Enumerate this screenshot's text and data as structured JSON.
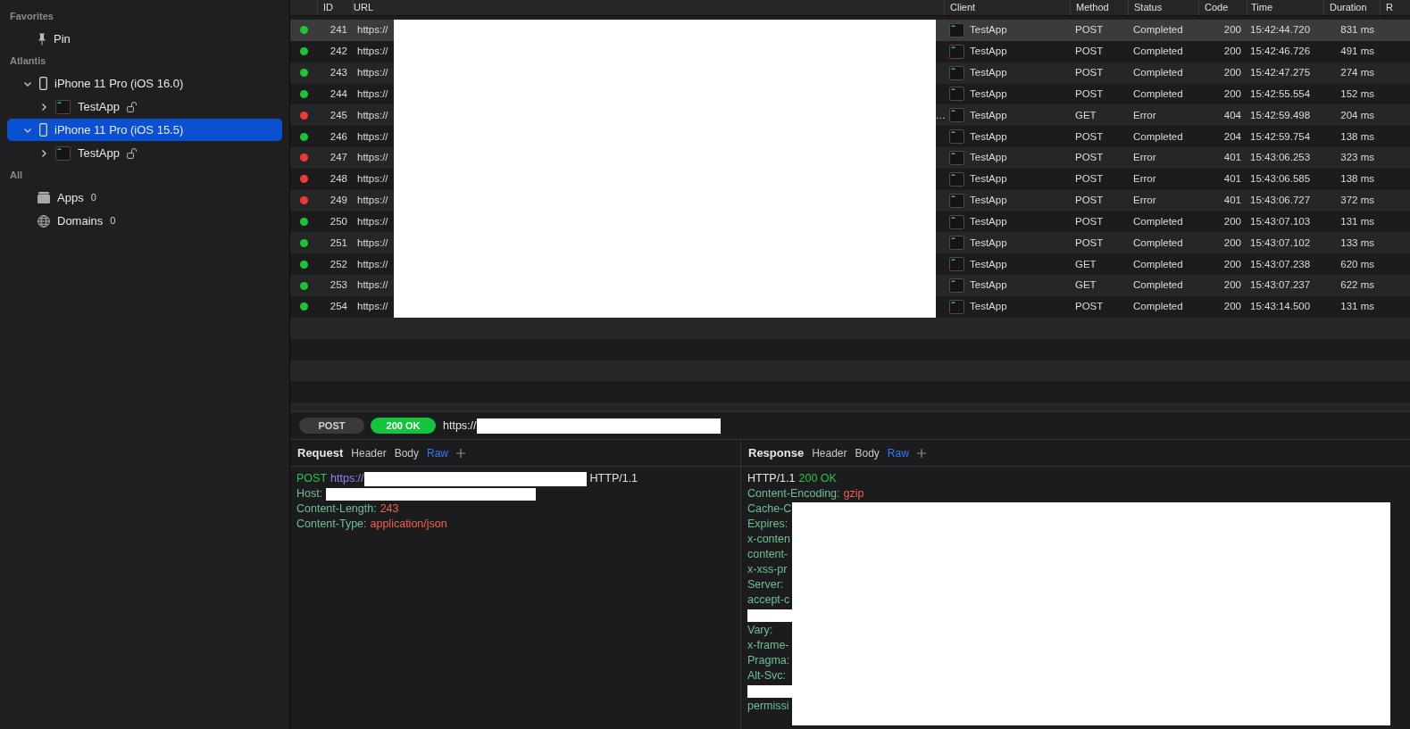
{
  "sidebar": {
    "sections": [
      {
        "title": "Favorites",
        "items": [
          {
            "kind": "pin",
            "label": "Pin",
            "selected": false
          }
        ]
      },
      {
        "title": "Atlantis",
        "items": [
          {
            "kind": "device",
            "label": "iPhone 11 Pro (iOS 16.0)",
            "selected": false,
            "expanded": true,
            "children": [
              {
                "kind": "app",
                "label": "TestApp",
                "selected": false,
                "expanded": false
              }
            ]
          },
          {
            "kind": "device",
            "label": "iPhone 11 Pro (iOS 15.5)",
            "selected": true,
            "expanded": true,
            "children": [
              {
                "kind": "app",
                "label": "TestApp",
                "selected": false,
                "expanded": false
              }
            ]
          }
        ]
      },
      {
        "title": "All",
        "items": [
          {
            "kind": "apps",
            "label": "Apps",
            "count": "0",
            "selected": false
          },
          {
            "kind": "domains",
            "label": "Domains",
            "count": "0",
            "selected": false
          }
        ]
      }
    ]
  },
  "table": {
    "columns": [
      "ID",
      "URL",
      "Client",
      "Method",
      "Status",
      "Code",
      "Time",
      "Duration",
      "R"
    ],
    "rows": [
      {
        "id": "241",
        "url": "https://",
        "client": "TestApp",
        "method": "POST",
        "status": "Completed",
        "code": "200",
        "time": "15:42:44.720",
        "duration": "831 ms",
        "color": "#1ec337",
        "selected": true
      },
      {
        "id": "242",
        "url": "https://",
        "client": "TestApp",
        "method": "POST",
        "status": "Completed",
        "code": "200",
        "time": "15:42:46.726",
        "duration": "491 ms",
        "color": "#1ec337",
        "selected": false
      },
      {
        "id": "243",
        "url": "https://",
        "client": "TestApp",
        "method": "POST",
        "status": "Completed",
        "code": "200",
        "time": "15:42:47.275",
        "duration": "274 ms",
        "color": "#1ec337",
        "selected": false
      },
      {
        "id": "244",
        "url": "https://",
        "client": "TestApp",
        "method": "POST",
        "status": "Completed",
        "code": "200",
        "time": "15:42:55.554",
        "duration": "152 ms",
        "color": "#1ec337",
        "selected": false
      },
      {
        "id": "245",
        "url": "https://",
        "url_end": "…",
        "client": "TestApp",
        "method": "GET",
        "status": "Error",
        "code": "404",
        "time": "15:42:59.498",
        "duration": "204 ms",
        "color": "#f0393a",
        "selected": false
      },
      {
        "id": "246",
        "url": "https://",
        "client": "TestApp",
        "method": "POST",
        "status": "Completed",
        "code": "204",
        "time": "15:42:59.754",
        "duration": "138 ms",
        "color": "#1ec337",
        "selected": false
      },
      {
        "id": "247",
        "url": "https://",
        "client": "TestApp",
        "method": "POST",
        "status": "Error",
        "code": "401",
        "time": "15:43:06.253",
        "duration": "323 ms",
        "color": "#f0393a",
        "selected": false
      },
      {
        "id": "248",
        "url": "https://",
        "client": "TestApp",
        "method": "POST",
        "status": "Error",
        "code": "401",
        "time": "15:43:06.585",
        "duration": "138 ms",
        "color": "#f0393a",
        "selected": false
      },
      {
        "id": "249",
        "url": "https://",
        "client": "TestApp",
        "method": "POST",
        "status": "Error",
        "code": "401",
        "time": "15:43:06.727",
        "duration": "372 ms",
        "color": "#f0393a",
        "selected": false
      },
      {
        "id": "250",
        "url": "https://",
        "client": "TestApp",
        "method": "POST",
        "status": "Completed",
        "code": "200",
        "time": "15:43:07.103",
        "duration": "131 ms",
        "color": "#1ec337",
        "selected": false
      },
      {
        "id": "251",
        "url": "https://",
        "client": "TestApp",
        "method": "POST",
        "status": "Completed",
        "code": "200",
        "time": "15:43:07.102",
        "duration": "133 ms",
        "color": "#1ec337",
        "selected": false
      },
      {
        "id": "252",
        "url": "https://",
        "client": "TestApp",
        "method": "GET",
        "status": "Completed",
        "code": "200",
        "time": "15:43:07.238",
        "duration": "620 ms",
        "color": "#1ec337",
        "selected": false
      },
      {
        "id": "253",
        "url": "https://",
        "client": "TestApp",
        "method": "GET",
        "status": "Completed",
        "code": "200",
        "time": "15:43:07.237",
        "duration": "622 ms",
        "color": "#1ec337",
        "selected": false
      },
      {
        "id": "254",
        "url": "https://",
        "client": "TestApp",
        "method": "POST",
        "status": "Completed",
        "code": "200",
        "time": "15:43:14.500",
        "duration": "131 ms",
        "color": "#1ec337",
        "selected": false
      }
    ]
  },
  "url_bar": {
    "method": "POST",
    "status": "200 OK",
    "url": "https://"
  },
  "request": {
    "title": "Request",
    "tabs": [
      {
        "label": "Header",
        "selected": false
      },
      {
        "label": "Body",
        "selected": false
      },
      {
        "label": "Raw",
        "selected": true
      }
    ],
    "lines": [
      {
        "kind": "request_line",
        "method": "POST",
        "url": "https://",
        "version": "HTTP/1.1"
      },
      {
        "kind": "redacted_header",
        "name": "Host:"
      },
      {
        "kind": "header",
        "name": "Content-Length:",
        "value": "243"
      },
      {
        "kind": "header",
        "name": "Content-Type:",
        "value": "application/json"
      }
    ]
  },
  "response": {
    "title": "Response",
    "tabs": [
      {
        "label": "Header",
        "selected": false
      },
      {
        "label": "Body",
        "selected": false
      },
      {
        "label": "Raw",
        "selected": true
      }
    ],
    "lines": [
      {
        "kind": "status_line",
        "version": "HTTP/1.1",
        "status": "200 OK"
      },
      {
        "kind": "header",
        "name": "Content-Encoding:",
        "value": "gzip"
      },
      {
        "kind": "cut",
        "text": "Cache-C"
      },
      {
        "kind": "cut",
        "text": "Expires:"
      },
      {
        "kind": "cut",
        "text": "x-conten"
      },
      {
        "kind": "cut",
        "text": "content-"
      },
      {
        "kind": "cut",
        "text": "x-xss-pr"
      },
      {
        "kind": "cut",
        "text": "Server:"
      },
      {
        "kind": "cut",
        "text": "accept-c"
      },
      {
        "kind": "redacted"
      },
      {
        "kind": "cut",
        "text": "Vary:"
      },
      {
        "kind": "cut",
        "text": "x-frame-"
      },
      {
        "kind": "cut",
        "text": "Pragma:"
      },
      {
        "kind": "cut",
        "text": "Alt-Svc:"
      },
      {
        "kind": "redacted"
      },
      {
        "kind": "cut",
        "text": "permissi"
      }
    ]
  }
}
